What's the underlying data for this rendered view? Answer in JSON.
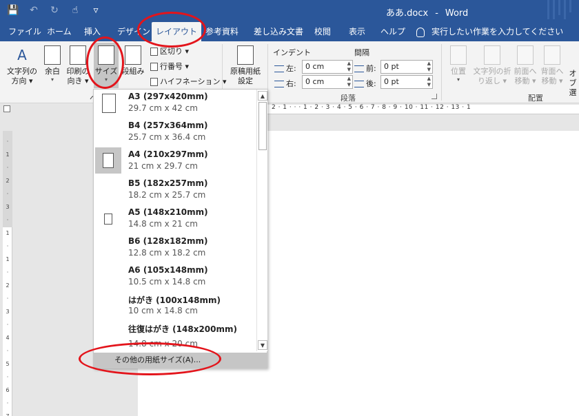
{
  "title_bar": {
    "doc_name": "ああ.docx",
    "separator": "-",
    "app_name": "Word",
    "qat": {
      "save_icon": "💾",
      "undo_icon": "↶",
      "redo_icon": "↻",
      "touch_icon": "☝",
      "customize_icon": "▿"
    }
  },
  "tabs": [
    {
      "label": "ファイル"
    },
    {
      "label": "ホーム"
    },
    {
      "label": "挿入"
    },
    {
      "label": "デザイン"
    },
    {
      "label": "レイアウト"
    },
    {
      "label": "参考資料"
    },
    {
      "label": "差し込み文書"
    },
    {
      "label": "校閲"
    },
    {
      "label": "表示"
    },
    {
      "label": "ヘルプ"
    }
  ],
  "tell_me": "実行したい作業を入力してください",
  "ribbon": {
    "page_setup": {
      "text_direction": "文字列の\n方向 ▾",
      "margins": "余白",
      "orientation": "印刷の\n向き ▾",
      "size": "サイズ",
      "columns": "段組み",
      "breaks": "区切り ▾",
      "line_numbers": "行番号 ▾",
      "hyphenation": "ハイフネーション ▾",
      "group_label": "ペ"
    },
    "manuscript": {
      "label": "原稿用紙\n設定"
    },
    "indent": {
      "label": "インデント",
      "left_label": "左:",
      "left_value": "0 cm",
      "right_label": "右:",
      "right_value": "0 cm"
    },
    "spacing": {
      "label": "間隔",
      "before_label": "前:",
      "before_value": "0 pt",
      "after_label": "後:",
      "after_value": "0 pt"
    },
    "paragraph_group_label": "段落",
    "arrange": {
      "position": "位置",
      "wrap_text": "文字列の折\nり返し ▾",
      "bring_forward": "前面へ\n移動 ▾",
      "send_backward": "背面へ\n移動 ▾",
      "selection": "オブ\n選",
      "group_label": "配置"
    }
  },
  "hruler_ticks": "2 · 1 · · · 1 · 2 · 3 · 4 · 5 · 6 · 7 · 8 · 9 · 10 · 11 · 12 · 13 · 1",
  "size_dropdown": {
    "options": [
      {
        "name": "A3 (297x420mm)",
        "dims": "29.7 cm x 42 cm"
      },
      {
        "name": "B4 (257x364mm)",
        "dims": "25.7 cm x 36.4 cm"
      },
      {
        "name": "A4 (210x297mm)",
        "dims": "21 cm x 29.7 cm",
        "selected": true
      },
      {
        "name": "B5 (182x257mm)",
        "dims": "18.2 cm x 25.7 cm"
      },
      {
        "name": "A5 (148x210mm)",
        "dims": "14.8 cm x 21 cm"
      },
      {
        "name": "B6 (128x182mm)",
        "dims": "12.8 cm x 18.2 cm"
      },
      {
        "name": "A6 (105x148mm)",
        "dims": "10.5 cm x 14.8 cm"
      },
      {
        "name": "はがき (100x148mm)",
        "dims": "10 cm x 14.8 cm"
      },
      {
        "name": "往復はがき (148x200mm)",
        "dims": "14.8 cm x 20 cm"
      }
    ],
    "more_sizes": "その他の用紙サイズ(A)..."
  },
  "colors": {
    "word_blue": "#2b579a",
    "annotation_red": "#e3141b"
  }
}
